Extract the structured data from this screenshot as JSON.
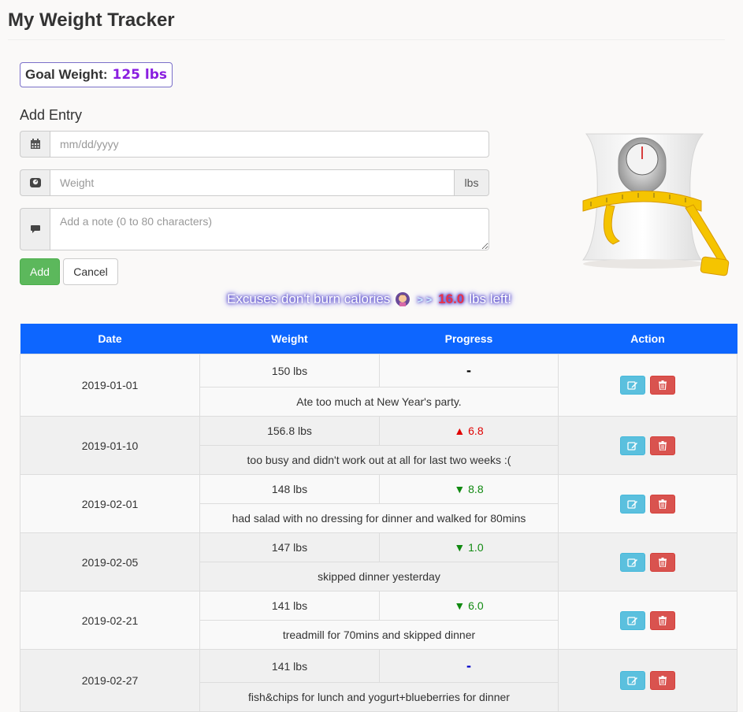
{
  "app": {
    "title": "My Weight Tracker"
  },
  "goal": {
    "label": "Goal Weight:",
    "value": "125 lbs"
  },
  "add_entry": {
    "heading": "Add Entry",
    "date_placeholder": "mm/dd/yyyy",
    "weight_placeholder": "Weight",
    "weight_unit": "lbs",
    "note_placeholder": "Add a note (0 to 80 characters)",
    "add_label": "Add",
    "cancel_label": "Cancel"
  },
  "motivation": {
    "text": "Excuses don't burn calories",
    "arrows": "> >",
    "remaining": "16.0",
    "suffix": "lbs left!"
  },
  "table": {
    "headers": [
      "Date",
      "Weight",
      "Progress",
      "Action"
    ],
    "rows": [
      {
        "date": "2019-01-01",
        "weight": "150 lbs",
        "progress": "-",
        "note": "Ate too much at New Year's party."
      },
      {
        "date": "2019-01-10",
        "weight": "156.8 lbs",
        "progress": "▲ 6.8",
        "note": "too busy and didn't work out at all for last two weeks :("
      },
      {
        "date": "2019-02-01",
        "weight": "148 lbs",
        "progress": "▼ 8.8",
        "note": "had salad with no dressing for dinner and walked for 80mins"
      },
      {
        "date": "2019-02-05",
        "weight": "147 lbs",
        "progress": "▼ 1.0",
        "note": "skipped dinner yesterday"
      },
      {
        "date": "2019-02-21",
        "weight": "141 lbs",
        "progress": "▼ 6.0",
        "note": "treadmill for 70mins and skipped dinner"
      },
      {
        "date": "2019-02-27",
        "weight": "141 lbs",
        "progress": "-",
        "note": "fish&chips for lunch and yogurt+blueberries for dinner"
      }
    ]
  },
  "colors": {
    "header_bg": "#0d66ff",
    "goal_value": "#8a1ee0",
    "gain": "#e00000",
    "loss": "#118a11",
    "add_button": "#5cb85c",
    "edit_button": "#5bc0de",
    "delete_button": "#d9534f"
  },
  "icons": [
    "calendar-icon",
    "scale-icon",
    "comment-icon",
    "edit-icon",
    "trash-icon",
    "emoji-woman-icon"
  ]
}
